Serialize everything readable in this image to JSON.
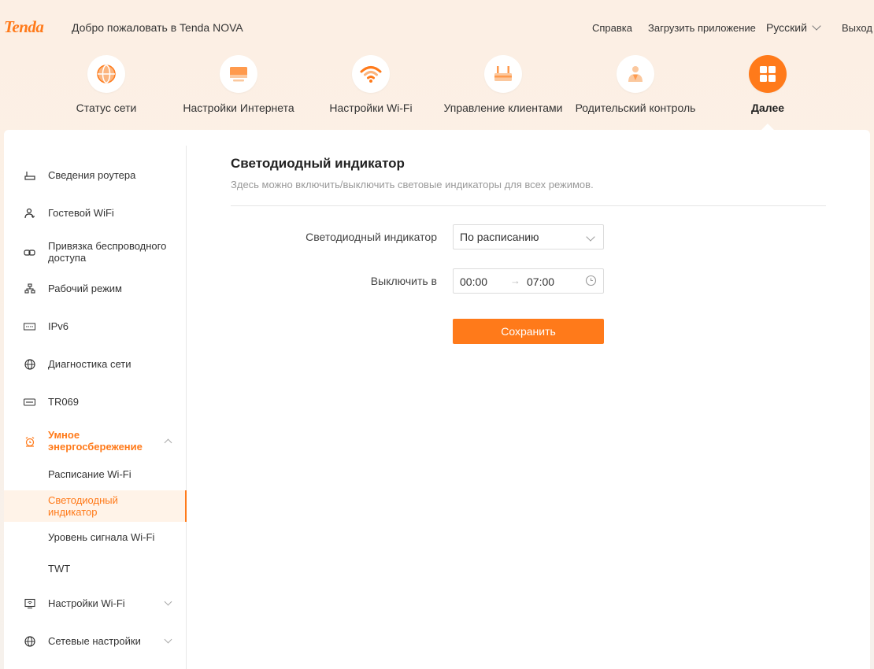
{
  "header": {
    "logo": "Tenda",
    "welcome": "Добро пожаловать в Tenda NOVA",
    "links": {
      "help": "Справка",
      "download_app": "Загрузить приложение",
      "language": "Русский",
      "logout": "Выход"
    }
  },
  "nav": {
    "items": [
      {
        "label": "Статус сети",
        "icon": "globe-icon"
      },
      {
        "label": "Настройки Интернета",
        "icon": "monitor-icon"
      },
      {
        "label": "Настройки Wi-Fi",
        "icon": "wifi-icon"
      },
      {
        "label": "Управление клиентами",
        "icon": "router-icon"
      },
      {
        "label": "Родительский контроль",
        "icon": "parent-icon"
      },
      {
        "label": "Далее",
        "icon": "grid-icon",
        "active": true
      }
    ],
    "accent_color": "#ff7a1a"
  },
  "sidebar": {
    "items": [
      {
        "label": "Сведения роутера",
        "icon": "router-icon"
      },
      {
        "label": "Гостевой WiFi",
        "icon": "guest-icon"
      },
      {
        "label": "Привязка беспроводного доступа",
        "icon": "link-icon"
      },
      {
        "label": "Рабочий режим",
        "icon": "mode-icon"
      },
      {
        "label": "IPv6",
        "icon": "ipv6-icon"
      },
      {
        "label": "Диагностика сети",
        "icon": "globe-icon"
      },
      {
        "label": "TR069",
        "icon": "tr069-icon"
      },
      {
        "label": "Умное энергосбережение",
        "icon": "alarm-icon",
        "expanded": true
      },
      {
        "label": "Настройки Wi-Fi",
        "icon": "monitor-wifi-icon"
      },
      {
        "label": "Сетевые настройки",
        "icon": "globe-icon"
      }
    ],
    "subitems": [
      {
        "label": "Расписание Wi-Fi"
      },
      {
        "label": "Светодиодный индикатор",
        "active": true
      },
      {
        "label": "Уровень сигнала Wi-Fi"
      },
      {
        "label": "TWT"
      }
    ]
  },
  "main": {
    "title": "Светодиодный индикатор",
    "description": "Здесь можно включить/выключить световые индикаторы для всех режимов.",
    "led_label": "Светодиодный индикатор",
    "led_value": "По расписанию",
    "off_label": "Выключить в",
    "time_start": "00:00",
    "time_arrow": "→",
    "time_end": "07:00",
    "save_label": "Сохранить"
  }
}
